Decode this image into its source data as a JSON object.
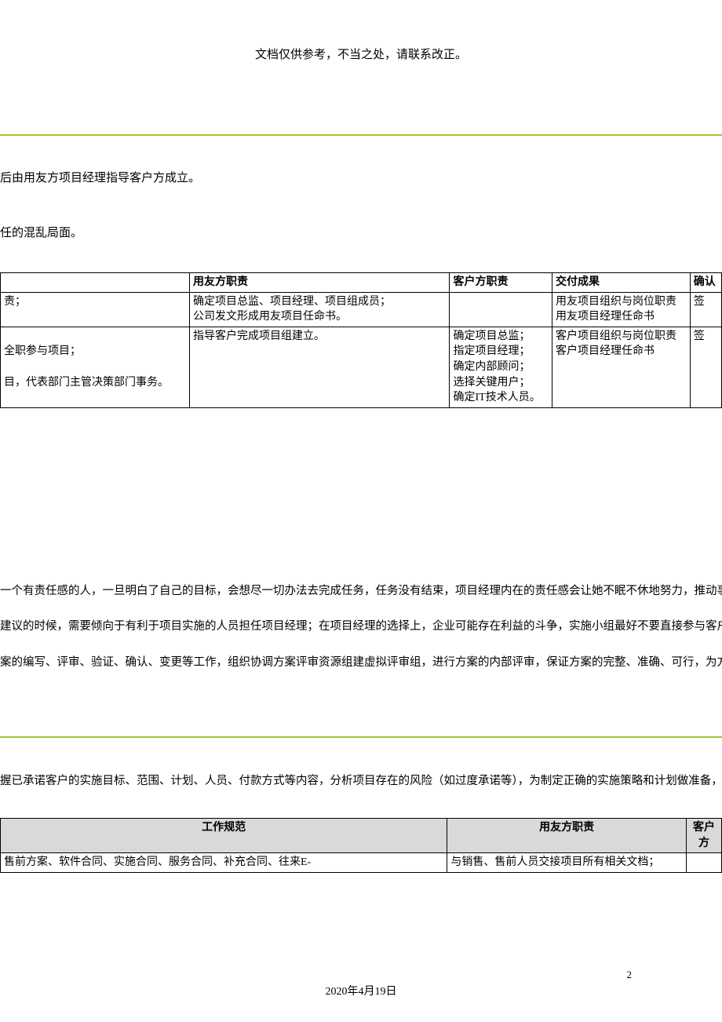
{
  "header": {
    "notice": "文档仅供参考，不当之处，请联系改正。"
  },
  "intro": {
    "line1": "后由用友方项目经理指导客户方成立。",
    "line2": "任的混乱局面。"
  },
  "table1": {
    "headers": {
      "col1": "",
      "col2": "用友方职责",
      "col3": "客户方职责",
      "col4": "交付成果",
      "col5": "确认"
    },
    "rows": [
      {
        "c1": "责；",
        "c2": "确定项目总监、项目经理、项目组成员；\n公司发文形成用友项目任命书。",
        "c3": "",
        "c4": "用友项目组织与岗位职责\n用友项目经理任命书",
        "c5": "签"
      },
      {
        "c1": "\n  全职参与项目；\n\n目，代表部门主管决策部门事务。",
        "c2": "指导客户完成项目组建立。",
        "c3": "确定项目总监；\n指定项目经理；\n确定内部顾问；\n选择关键用户；\n确定IT技术人员。",
        "c4": "客户项目组织与岗位职责\n客户项目经理任命书",
        "c5": "签"
      }
    ]
  },
  "body_paras": {
    "p1": "一个有责任感的人，一旦明白了自己的目标，会想尽一切办法去完成任务，任务没有结束，项目经理内在的责任感会让她不眠不休地努力，推动事情往",
    "p2": "建议的时候，需要倾向于有利于项目实施的人员担任项目经理；在项目经理的选择上，企业可能存在利益的斗争，实施小组最好不要直接参与客户的内部",
    "p3": "案的编写、评审、验证、确认、变更等工作，组织协调方案评审资源组建虚拟评审组，进行方案的内部评审，保证方案的完整、准确、可行，为方案落地"
  },
  "after_mid": {
    "p1": "握已承诺客户的实施目标、范围、计划、人员、付款方式等内容，分析项目存在的风险（如过度承诺等），为制定正确的实施策略和计划做准备，充分"
  },
  "table2": {
    "headers": {
      "col1": "工作规范",
      "col2": "用友方职责",
      "col3": "客户方"
    },
    "rows": [
      {
        "c1": "售前方案、软件合同、实施合同、服务合同、补充合同、往来E-",
        "c2": "与销售、售前人员交接项目所有相关文档；",
        "c3": ""
      }
    ]
  },
  "footer": {
    "date": "2020年4月19日",
    "page": "2"
  }
}
